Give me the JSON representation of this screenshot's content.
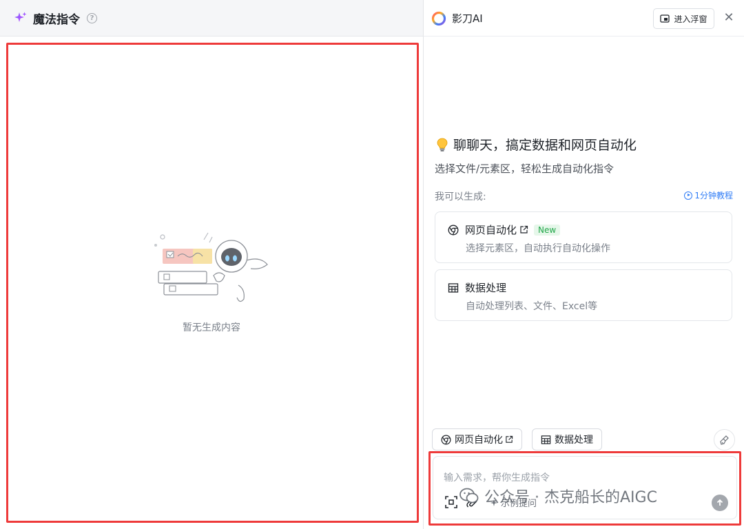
{
  "left_panel": {
    "title": "魔法指令",
    "help_icon": "?",
    "empty_text": "暂无生成内容"
  },
  "right_panel": {
    "brand": "影刀AI",
    "float_button": "进入浮窗",
    "close_icon": "✕",
    "welcome_title": "聊聊天，搞定数据和网页自动化",
    "welcome_subtitle": "选择文件/元素区，轻松生成自动化指令",
    "can_generate_label": "我可以生成:",
    "tutorial_link": "1分钟教程",
    "cards": [
      {
        "title": "网页自动化",
        "badge": "New",
        "desc": "选择元素区，自动执行自动化操作"
      },
      {
        "title": "数据处理",
        "desc": "自动处理列表、文件、Excel等"
      }
    ],
    "quick_buttons": [
      {
        "label": "网页自动化"
      },
      {
        "label": "数据处理"
      }
    ],
    "input": {
      "placeholder": "输入需求，帮你生成指令",
      "examples_label": "示例提问"
    }
  },
  "watermark": "公众号 · 杰克船长的AIGC",
  "colors": {
    "highlight_frame": "#ee3a3a",
    "accent_link": "#2f7cf6",
    "new_badge_text": "#22a74a",
    "new_badge_bg": "#e6f7ea"
  },
  "icons": {
    "title_icon": "sparkle-icon",
    "logo": "yingdao-logo-icon",
    "welcome": "lightbulb-icon",
    "web_automation": "chrome-icon",
    "data_processing": "table-icon"
  }
}
